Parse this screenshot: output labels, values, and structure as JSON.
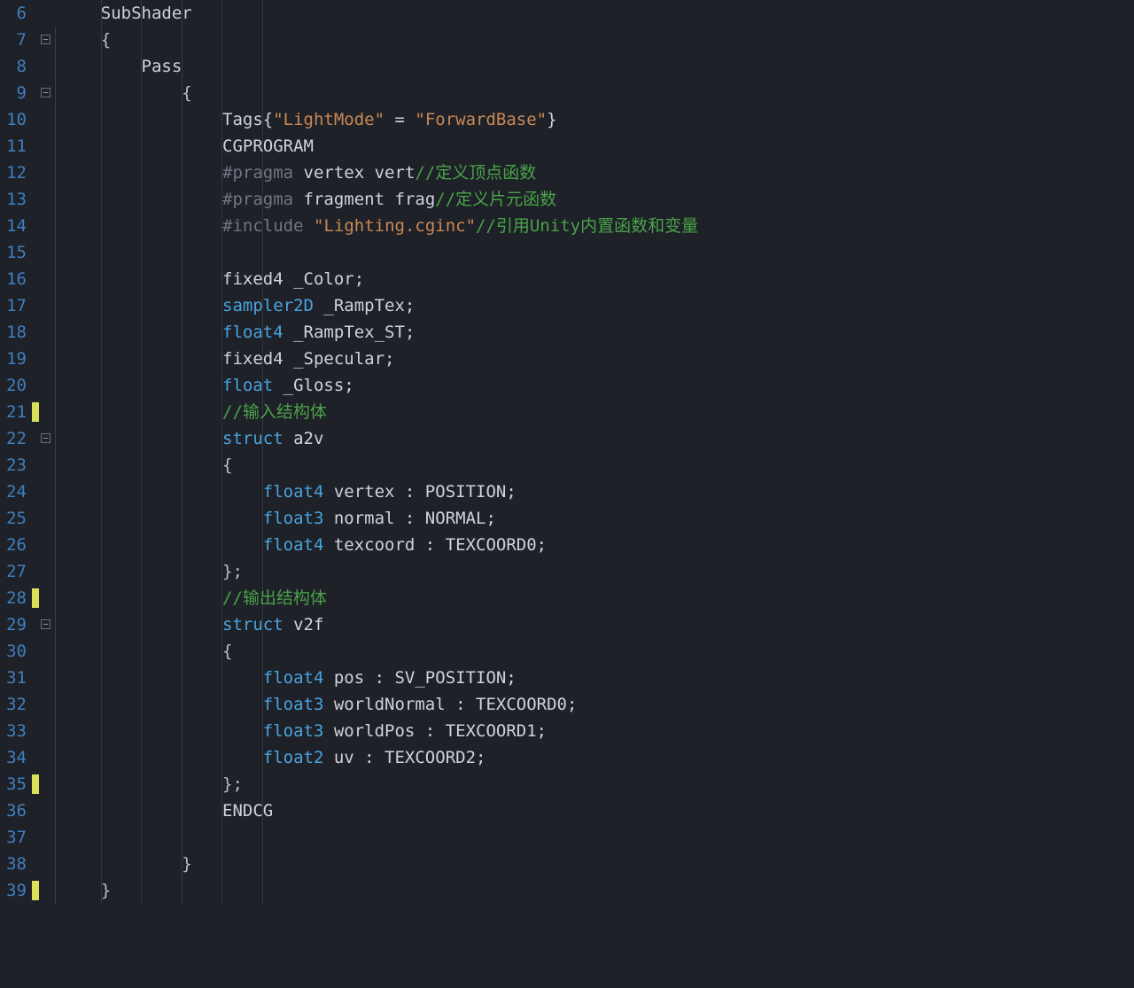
{
  "startLine": 6,
  "markerLines": [
    21,
    28,
    35,
    39
  ],
  "foldLines": [
    7,
    9,
    22,
    29
  ],
  "lines": [
    {
      "n": 6,
      "indent": 1,
      "t": [
        {
          "c": "plain",
          "s": "SubShader"
        }
      ]
    },
    {
      "n": 7,
      "indent": 1,
      "t": [
        {
          "c": "punct",
          "s": "{"
        }
      ]
    },
    {
      "n": 8,
      "indent": 2,
      "t": [
        {
          "c": "plain",
          "s": "Pass"
        }
      ]
    },
    {
      "n": 9,
      "indent": 3,
      "t": [
        {
          "c": "punct",
          "s": "{"
        }
      ]
    },
    {
      "n": 10,
      "indent": 4,
      "t": [
        {
          "c": "plain",
          "s": "Tags{"
        },
        {
          "c": "str",
          "s": "\"LightMode\""
        },
        {
          "c": "plain",
          "s": " = "
        },
        {
          "c": "str",
          "s": "\"ForwardBase\""
        },
        {
          "c": "plain",
          "s": "}"
        }
      ]
    },
    {
      "n": 11,
      "indent": 4,
      "t": [
        {
          "c": "plain",
          "s": "CGPROGRAM"
        }
      ]
    },
    {
      "n": 12,
      "indent": 4,
      "t": [
        {
          "c": "pragma",
          "s": "#pragma"
        },
        {
          "c": "plain",
          "s": " vertex vert"
        },
        {
          "c": "comment",
          "s": "//定义顶点函数"
        }
      ]
    },
    {
      "n": 13,
      "indent": 4,
      "t": [
        {
          "c": "pragma",
          "s": "#pragma"
        },
        {
          "c": "plain",
          "s": " fragment frag"
        },
        {
          "c": "comment",
          "s": "//定义片元函数"
        }
      ]
    },
    {
      "n": 14,
      "indent": 4,
      "t": [
        {
          "c": "pragma",
          "s": "#include"
        },
        {
          "c": "plain",
          "s": " "
        },
        {
          "c": "str",
          "s": "\"Lighting.cginc\""
        },
        {
          "c": "comment",
          "s": "//引用Unity内置函数和变量"
        }
      ]
    },
    {
      "n": 15,
      "indent": 4,
      "t": [
        {
          "c": "plain",
          "s": ""
        }
      ]
    },
    {
      "n": 16,
      "indent": 4,
      "t": [
        {
          "c": "plain",
          "s": "fixed4 _Color;"
        }
      ]
    },
    {
      "n": 17,
      "indent": 4,
      "t": [
        {
          "c": "type",
          "s": "sampler2D"
        },
        {
          "c": "plain",
          "s": " _RampTex;"
        }
      ]
    },
    {
      "n": 18,
      "indent": 4,
      "t": [
        {
          "c": "type",
          "s": "float4"
        },
        {
          "c": "plain",
          "s": " _RampTex_ST;"
        }
      ]
    },
    {
      "n": 19,
      "indent": 4,
      "t": [
        {
          "c": "plain",
          "s": "fixed4 _Specular;"
        }
      ]
    },
    {
      "n": 20,
      "indent": 4,
      "t": [
        {
          "c": "type",
          "s": "float"
        },
        {
          "c": "plain",
          "s": " _Gloss;"
        }
      ]
    },
    {
      "n": 21,
      "indent": 4,
      "t": [
        {
          "c": "comment",
          "s": "//输入结构体"
        }
      ]
    },
    {
      "n": 22,
      "indent": 4,
      "t": [
        {
          "c": "type",
          "s": "struct"
        },
        {
          "c": "plain",
          "s": " a2v"
        }
      ]
    },
    {
      "n": 23,
      "indent": 4,
      "t": [
        {
          "c": "punct",
          "s": "{"
        }
      ]
    },
    {
      "n": 24,
      "indent": 5,
      "t": [
        {
          "c": "type",
          "s": "float4"
        },
        {
          "c": "plain",
          "s": " vertex : POSITION;"
        }
      ]
    },
    {
      "n": 25,
      "indent": 5,
      "t": [
        {
          "c": "type",
          "s": "float3"
        },
        {
          "c": "plain",
          "s": " normal : NORMAL;"
        }
      ]
    },
    {
      "n": 26,
      "indent": 5,
      "t": [
        {
          "c": "type",
          "s": "float4"
        },
        {
          "c": "plain",
          "s": " texcoord : TEXCOORD0;"
        }
      ]
    },
    {
      "n": 27,
      "indent": 4,
      "t": [
        {
          "c": "punct",
          "s": "};"
        }
      ]
    },
    {
      "n": 28,
      "indent": 4,
      "t": [
        {
          "c": "comment",
          "s": "//输出结构体"
        }
      ]
    },
    {
      "n": 29,
      "indent": 4,
      "t": [
        {
          "c": "type",
          "s": "struct"
        },
        {
          "c": "plain",
          "s": " v2f"
        }
      ]
    },
    {
      "n": 30,
      "indent": 4,
      "t": [
        {
          "c": "punct",
          "s": "{"
        }
      ]
    },
    {
      "n": 31,
      "indent": 5,
      "t": [
        {
          "c": "type",
          "s": "float4"
        },
        {
          "c": "plain",
          "s": " pos : SV_POSITION;"
        }
      ]
    },
    {
      "n": 32,
      "indent": 5,
      "t": [
        {
          "c": "type",
          "s": "float3"
        },
        {
          "c": "plain",
          "s": " worldNormal : TEXCOORD0;"
        }
      ]
    },
    {
      "n": 33,
      "indent": 5,
      "t": [
        {
          "c": "type",
          "s": "float3"
        },
        {
          "c": "plain",
          "s": " worldPos : TEXCOORD1;"
        }
      ]
    },
    {
      "n": 34,
      "indent": 5,
      "t": [
        {
          "c": "type",
          "s": "float2"
        },
        {
          "c": "plain",
          "s": " uv : TEXCOORD2;"
        }
      ]
    },
    {
      "n": 35,
      "indent": 4,
      "t": [
        {
          "c": "punct",
          "s": "};"
        }
      ]
    },
    {
      "n": 36,
      "indent": 4,
      "t": [
        {
          "c": "plain",
          "s": "ENDCG"
        }
      ]
    },
    {
      "n": 37,
      "indent": 4,
      "t": [
        {
          "c": "plain",
          "s": ""
        }
      ]
    },
    {
      "n": 38,
      "indent": 3,
      "t": [
        {
          "c": "punct",
          "s": "}"
        }
      ]
    },
    {
      "n": 39,
      "indent": 1,
      "t": [
        {
          "c": "punct",
          "s": "}"
        }
      ]
    }
  ],
  "indentWidthCh": 4,
  "baseOffsetPx": 88
}
